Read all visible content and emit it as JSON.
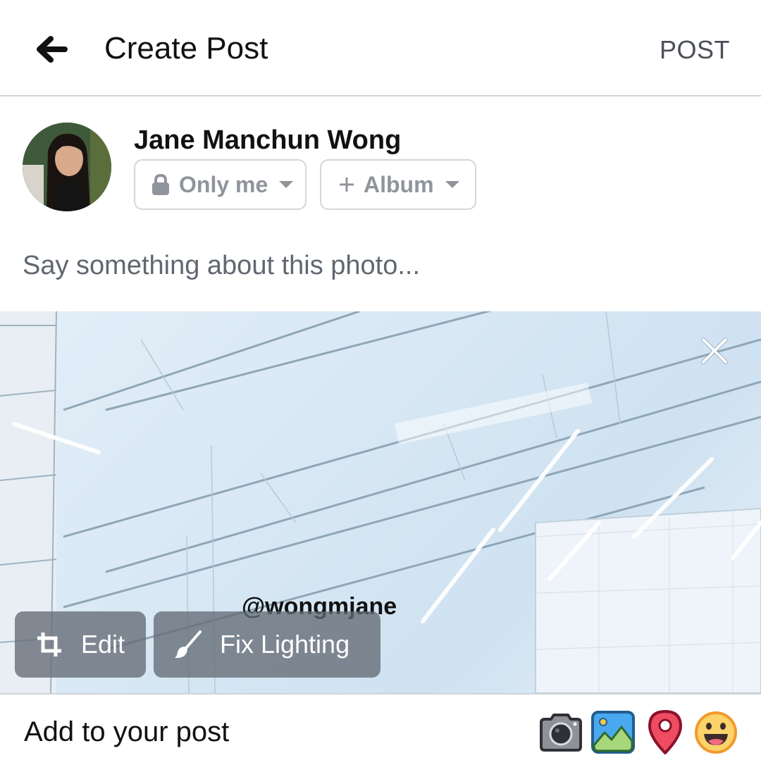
{
  "header": {
    "back_icon": "arrow-left-icon",
    "title": "Create Post",
    "post_label": "POST"
  },
  "author": {
    "name": "Jane Manchun Wong",
    "avatar_icon": "profile-photo"
  },
  "audience": {
    "privacy_icon": "lock-icon",
    "privacy_label": "Only me",
    "album_icon": "plus-icon",
    "album_label": "Album"
  },
  "composer": {
    "value": "",
    "placeholder": "Say something about this photo..."
  },
  "photo": {
    "watermark": "@wongmjane",
    "close_icon": "close-icon",
    "edit_label": "Edit",
    "edit_icon": "crop-icon",
    "fix_lighting_label": "Fix Lighting",
    "fix_lighting_icon": "brush-icon"
  },
  "add_to_post": {
    "label": "Add to your post",
    "tools": [
      {
        "name": "camera",
        "icon": "camera-icon"
      },
      {
        "name": "photo",
        "icon": "photo-icon"
      },
      {
        "name": "location",
        "icon": "location-pin-icon"
      },
      {
        "name": "feeling",
        "icon": "smiley-icon"
      }
    ]
  }
}
